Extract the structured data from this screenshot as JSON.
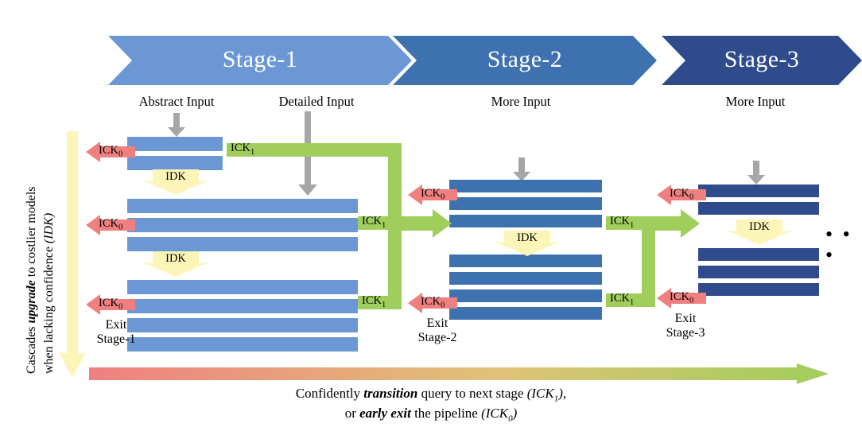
{
  "banner": {
    "stages": [
      {
        "label": "Stage-1",
        "color": "#6b98d4"
      },
      {
        "label": "Stage-2",
        "color": "#3e71b0"
      },
      {
        "label": "Stage-3",
        "color": "#2f4b8c"
      }
    ]
  },
  "inputs": [
    {
      "label": "Abstract Input"
    },
    {
      "label": "Detailed Input"
    },
    {
      "label": "More Input"
    },
    {
      "label": "More Input"
    }
  ],
  "labels": {
    "ick0": "ICK",
    "ick0_sub": "0",
    "ick1": "ICK",
    "ick1_sub": "1",
    "idk": "IDK",
    "ellipsis": "• • •"
  },
  "exits": [
    {
      "line1": "Exit",
      "line2": "Stage-1"
    },
    {
      "line1": "Exit",
      "line2": "Stage-2"
    },
    {
      "line1": "Exit",
      "line2": "Stage-3"
    }
  ],
  "side_caption": {
    "part1": "Cascades ",
    "emph1": "upgrade",
    "part2": " to costlier models",
    "part3": "when lacking confidence ",
    "emph2": "(IDK)"
  },
  "bottom_caption": {
    "line1_a": "Confidently ",
    "line1_emph": "transition",
    "line1_b": " query to next stage ",
    "line1_ick": "(ICK",
    "line1_ick_sub": "1",
    "line1_ick_end": "),",
    "line2_a": "or ",
    "line2_emph": "early exit",
    "line2_b": " the pipeline ",
    "line2_ick": "(ICK",
    "line2_ick_sub": "0",
    "line2_ick_end": ")"
  },
  "colors": {
    "stage1": "#6b98d4",
    "stage2": "#3e71b0",
    "stage3": "#2f4b8c",
    "green": "#a0ce5c",
    "red": "#f08080",
    "yellow": "#fbf6b8",
    "grey": "#a6a6a6",
    "gradient_start": "#ef8080",
    "gradient_end": "#a0ce5c"
  }
}
